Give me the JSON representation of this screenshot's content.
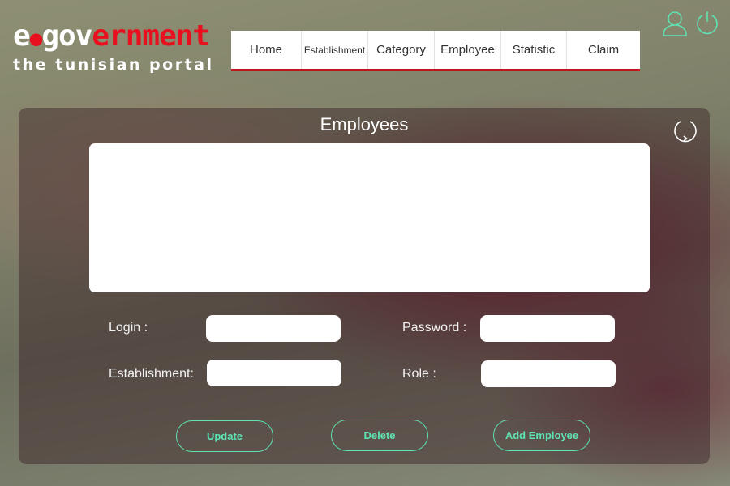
{
  "logo": {
    "part1": "e",
    "dot": "●",
    "part2": "gov",
    "part3": "ernment",
    "tagline": "the tunisian portal"
  },
  "nav": {
    "items": [
      {
        "label": "Home"
      },
      {
        "label": "Establishment"
      },
      {
        "label": "Category"
      },
      {
        "label": "Employee"
      },
      {
        "label": "Statistic"
      },
      {
        "label": "Claim"
      }
    ]
  },
  "header_icons": [
    "user-icon",
    "power-icon"
  ],
  "panel": {
    "title": "Employees",
    "refresh_icon": "refresh-icon"
  },
  "form": {
    "login_label": "Login :",
    "password_label": "Password :",
    "establishment_label": "Establishment:",
    "role_label": "Role :",
    "login_value": "",
    "password_value": "",
    "establishment_value": "",
    "role_value": ""
  },
  "buttons": {
    "update": "Update",
    "delete": "Delete",
    "add": "Add Employee"
  },
  "colors": {
    "accent": "#5fe3b3",
    "brand_red": "#e8101e",
    "nav_underline": "#c2121e"
  }
}
